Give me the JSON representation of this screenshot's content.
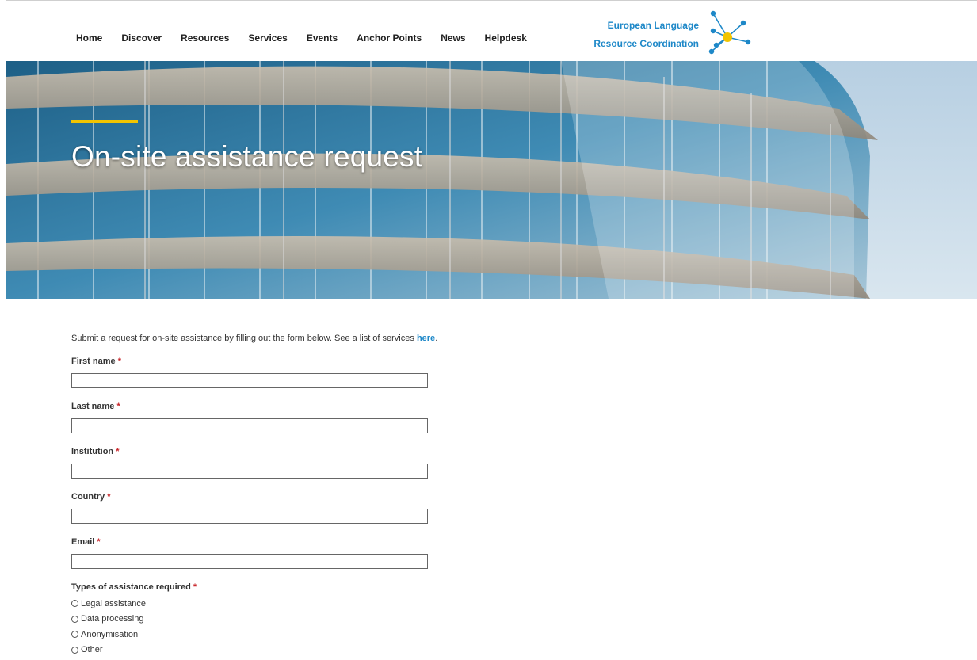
{
  "nav": {
    "items": [
      {
        "label": "Home"
      },
      {
        "label": "Discover"
      },
      {
        "label": "Resources"
      },
      {
        "label": "Services"
      },
      {
        "label": "Events"
      },
      {
        "label": "Anchor Points"
      },
      {
        "label": "News"
      },
      {
        "label": "Helpdesk"
      }
    ]
  },
  "logo": {
    "line1": "European Language",
    "line2": "Resource Coordination",
    "colors": {
      "text": "#1e88c8",
      "node": "#1e88c8",
      "hub": "#f2c400"
    }
  },
  "hero": {
    "title": "On-site assistance request",
    "accent_color": "#f2c400"
  },
  "form": {
    "intro_text": "Submit a request for on-site assistance by filling out the form below. See a list of services ",
    "intro_link": "here",
    "intro_suffix": ".",
    "required_marker": "*",
    "fields": [
      {
        "label": "First name",
        "value": ""
      },
      {
        "label": "Last name",
        "value": ""
      },
      {
        "label": "Institution",
        "value": ""
      },
      {
        "label": "Country",
        "value": ""
      },
      {
        "label": "Email",
        "value": ""
      }
    ],
    "assistance": {
      "label": "Types of assistance required",
      "options": [
        "Legal assistance",
        "Data processing",
        "Anonymisation",
        "Other"
      ]
    }
  }
}
